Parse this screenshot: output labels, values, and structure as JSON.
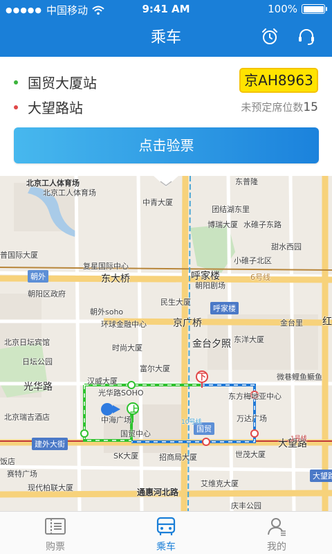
{
  "status_bar": {
    "carrier": "中国移动",
    "time": "9:41 AM",
    "battery": "100%"
  },
  "nav": {
    "title": "乘车",
    "icons": [
      "alarm-clock-icon",
      "customer-service-icon"
    ]
  },
  "trip": {
    "board_stop": "国贸大厦站",
    "alight_stop": "大望路站",
    "plate": "京AH8963",
    "seats_label": "未预定席位数",
    "seats_count": "15",
    "verify_button": "点击验票"
  },
  "map": {
    "labels": {
      "l1": "北京工人体育场",
      "l2": "北京工人体育场",
      "l3": "中青大厦",
      "l4": "东普隆",
      "l5": "团结湖东里",
      "l6": "博瑞大厦",
      "l7": "水碓子东路",
      "l8": "甜水西园",
      "l9": "普国际大厦",
      "l10": "复星国际中心",
      "l11": "小碓子北区",
      "l12": "朝外",
      "l13": "东大桥",
      "l14": "呼家楼",
      "l15": "朝阳剧场",
      "l16": "6号线",
      "l17": "朝阳区政府",
      "l18": "民生大厦",
      "l19": "呼家楼",
      "l20": "朝外soho",
      "l21": "环球金融中心",
      "l22": "京广桥",
      "l23": "金台里",
      "l24": "北京日坛宾馆",
      "l25": "时尚大厦",
      "l26": "金台夕照",
      "l27": "东洋大厦",
      "l28": "红",
      "l29": "日坛公园",
      "l30": "富尔大厦",
      "l31": "汉威大厦",
      "l32": "光华路",
      "l33": "光华路SOHO",
      "l34": "东方梅地亚中心",
      "l35": "微巷鲤鱼鳜鱼",
      "l36": "北京瑞吉酒店",
      "l37": "中海广场",
      "l38": "万达广场",
      "l39": "建外大街",
      "l40": "国贸中心",
      "l41": "国贸",
      "l42": "大望路",
      "l43": "饭店",
      "l44": "赛特广场",
      "l45": "SK大厦",
      "l46": "招商局大厦",
      "l47": "世茂大厦",
      "l48": "大望路",
      "l49": "现代柏联大厦",
      "l50": "艾维克大厦",
      "l51": "通惠河北路",
      "l52": "庆丰公园",
      "l53": "10号线",
      "l54": "1号线"
    },
    "markers": {
      "board": "上",
      "alight": "下"
    }
  },
  "tabs": [
    {
      "label": "购票",
      "icon": "ticket-icon"
    },
    {
      "label": "乘车",
      "icon": "bus-icon"
    },
    {
      "label": "我的",
      "icon": "user-icon"
    }
  ],
  "colors": {
    "primary": "#1a7fd8",
    "board_dot": "#3cb43c",
    "alight_dot": "#e04848",
    "route_green": "#2ec22e",
    "route_blue": "#1f78d6",
    "plate": "#ffe300"
  }
}
